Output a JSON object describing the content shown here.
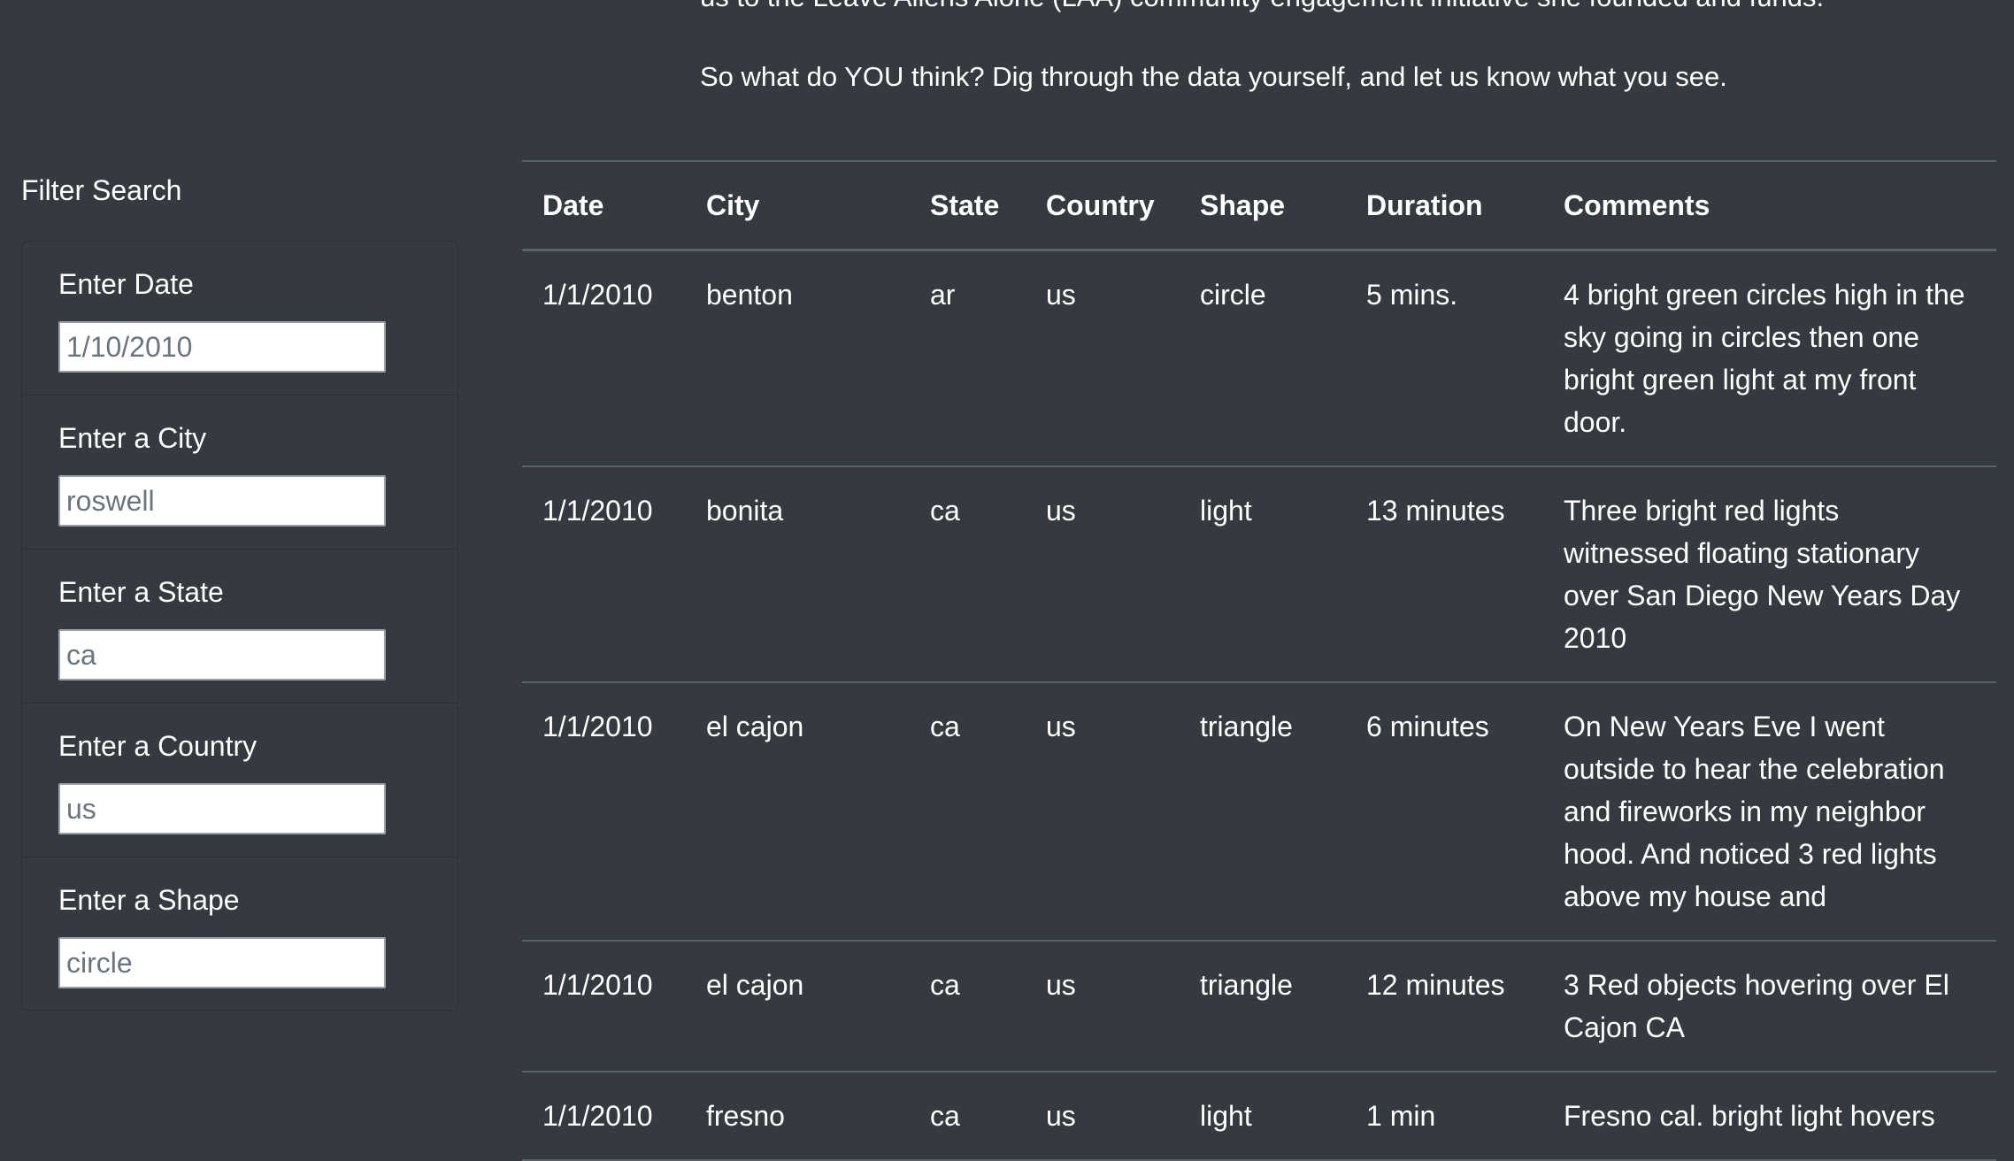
{
  "intro": {
    "cut_text": "us to the Leave Aliens Alone (LAA) community engagement initiative she founded and funds.",
    "question": "So what do YOU think? Dig through the data yourself, and let us know what you see."
  },
  "filters": {
    "title": "Filter Search",
    "date": {
      "label": "Enter Date",
      "placeholder": "1/10/2010"
    },
    "city": {
      "label": "Enter a City",
      "placeholder": "roswell"
    },
    "state": {
      "label": "Enter a State",
      "placeholder": "ca"
    },
    "country": {
      "label": "Enter a Country",
      "placeholder": "us"
    },
    "shape": {
      "label": "Enter a Shape",
      "placeholder": "circle"
    }
  },
  "table": {
    "headers": {
      "date": "Date",
      "city": "City",
      "state": "State",
      "country": "Country",
      "shape": "Shape",
      "duration": "Duration",
      "comments": "Comments"
    },
    "rows": [
      {
        "date": "1/1/2010",
        "city": "benton",
        "state": "ar",
        "country": "us",
        "shape": "circle",
        "duration": "5 mins.",
        "comments": "4 bright green circles high in the sky going in circles then one bright green light at my front door."
      },
      {
        "date": "1/1/2010",
        "city": "bonita",
        "state": "ca",
        "country": "us",
        "shape": "light",
        "duration": "13 minutes",
        "comments": "Three bright red lights witnessed floating stationary over San Diego New Years Day 2010"
      },
      {
        "date": "1/1/2010",
        "city": "el cajon",
        "state": "ca",
        "country": "us",
        "shape": "triangle",
        "duration": "6 minutes",
        "comments": "On New Years Eve I went outside to hear the celebration and fireworks in my neighbor hood. And noticed 3 red lights above my house and"
      },
      {
        "date": "1/1/2010",
        "city": "el cajon",
        "state": "ca",
        "country": "us",
        "shape": "triangle",
        "duration": "12 minutes",
        "comments": "3 Red objects hovering over El Cajon CA"
      },
      {
        "date": "1/1/2010",
        "city": "fresno",
        "state": "ca",
        "country": "us",
        "shape": "light",
        "duration": "1 min",
        "comments": "Fresno cal. bright light hovers"
      }
    ]
  }
}
